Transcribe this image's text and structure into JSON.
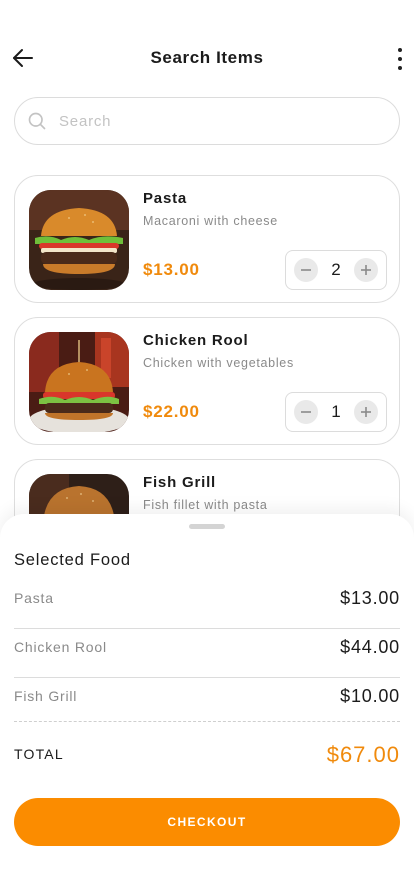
{
  "header": {
    "title": "Search Items"
  },
  "search": {
    "placeholder": "Search",
    "value": ""
  },
  "items": [
    {
      "name": "Pasta",
      "description": "Macaroni with cheese",
      "price": "$13.00",
      "quantity": "2"
    },
    {
      "name": "Chicken Rool",
      "description": "Chicken with vegetables",
      "price": "$22.00",
      "quantity": "1"
    },
    {
      "name": "Fish Grill",
      "description": "Fish fillet with pasta"
    }
  ],
  "sheet": {
    "title": "Selected Food",
    "rows": [
      {
        "name": "Pasta",
        "price": "$13.00"
      },
      {
        "name": "Chicken Rool",
        "price": "$44.00"
      },
      {
        "name": "Fish Grill",
        "price": "$10.00"
      }
    ],
    "total_label": "TOTAL",
    "total_value": "$67.00",
    "checkout_label": "CHECKOUT"
  },
  "colors": {
    "accent": "#fb8c00",
    "price": "#f08a0c",
    "border": "#dcdcdc",
    "muted": "#8a8a8a"
  },
  "icons": [
    "arrow-left-icon",
    "more-vertical-icon",
    "search-icon",
    "minus-icon",
    "plus-icon"
  ]
}
